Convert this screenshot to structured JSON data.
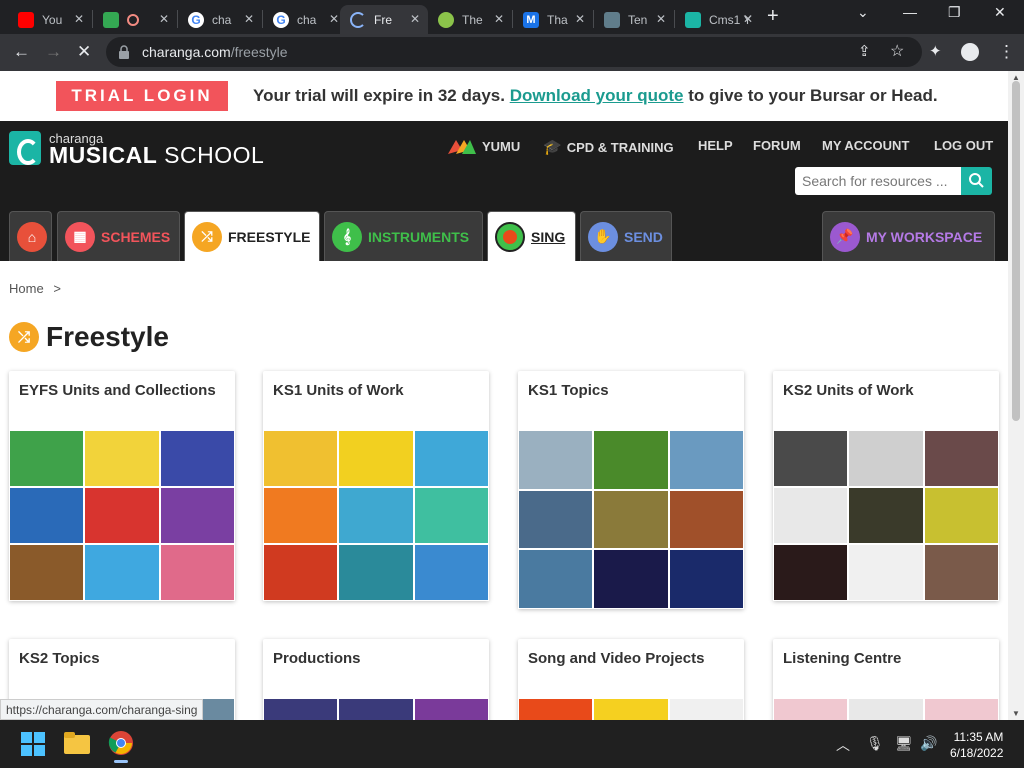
{
  "browser": {
    "tabs": [
      {
        "label": "You",
        "fav": "#ff0000",
        "icon": "youtube-icon"
      },
      {
        "label": "",
        "fav": "#34a853",
        "icon": "meet-icon"
      },
      {
        "label": "cha",
        "fav": "#ffffff",
        "icon": "google-icon"
      },
      {
        "label": "cha",
        "fav": "#ffffff",
        "icon": "google-icon"
      },
      {
        "label": "Fre",
        "fav": "#35363a",
        "icon": "loading-icon",
        "active": true
      },
      {
        "label": "The",
        "fav": "#8bc34a",
        "icon": "wrench-icon"
      },
      {
        "label": "Tha",
        "fav": "#1a73e8",
        "icon": "m-icon"
      },
      {
        "label": "Ten",
        "fav": "#607d8b",
        "icon": "mail-icon"
      },
      {
        "label": "Cms1 Y",
        "fav": "#1bb5a5",
        "icon": "charanga-icon"
      }
    ],
    "url_host": "charanga.com",
    "url_path": "/freestyle",
    "status_url": "https://charanga.com/charanga-sing"
  },
  "trial": {
    "login_label": "TRIAL LOGIN",
    "msg_before": "Your trial will expire in 32 days.",
    "link": "Download your quote",
    "msg_after": "to give to your Bursar or Head."
  },
  "header": {
    "logo_small": "charanga",
    "logo_bold": "MUSICAL",
    "logo_rest": "SCHOOL",
    "nav": [
      "YUMU",
      "CPD & TRAINING",
      "HELP",
      "FORUM",
      "MY ACCOUNT",
      "LOG OUT"
    ],
    "search_placeholder": "Search for resources ..."
  },
  "page_tabs": [
    {
      "label": "",
      "color": "#e8503a",
      "icon": "home-icon"
    },
    {
      "label": "SCHEMES",
      "color": "#f2545b",
      "icon": "grid-icon"
    },
    {
      "label": "FREESTYLE",
      "color": "#f5a623",
      "icon": "shuffle-icon",
      "selected": true
    },
    {
      "label": "INSTRUMENTS",
      "color": "#3fbf4a",
      "icon": "treble-clef-icon"
    },
    {
      "label": "SING",
      "color": "#222222",
      "icon": "singer-icon",
      "selected": true
    },
    {
      "label": "SEND",
      "color": "#6c8fe0",
      "icon": "hand-icon"
    },
    {
      "label": "MY WORKSPACE",
      "color": "#9b59d0",
      "icon": "pin-icon"
    }
  ],
  "breadcrumb": {
    "home": "Home",
    "sep": ">"
  },
  "page_title": "Freestyle",
  "cards": [
    {
      "title": "EYFS Units and Collections",
      "colors": [
        "#3fa24a",
        "#f2d33a",
        "#3a4aa8",
        "#2a6ab8",
        "#d8342f",
        "#7a3fa2",
        "#8a5a2a",
        "#3fa8e0",
        "#e06a8a"
      ]
    },
    {
      "title": "KS1 Units of Work",
      "colors": [
        "#f0c030",
        "#f2d020",
        "#3fa8d8",
        "#f07a20",
        "#3fa8d0",
        "#3fbfa0",
        "#d03a20",
        "#2a8a9a",
        "#3a8ad0"
      ]
    },
    {
      "title": "KS1 Topics",
      "colors": [
        "#9ab0c0",
        "#4a8a2a",
        "#6a9ac0",
        "#4a6a8a",
        "#8a7a3a",
        "#a0502a",
        "#4a7aa0",
        "#1a1a4a",
        "#1a2a6a"
      ]
    },
    {
      "title": "KS2 Units of Work",
      "colors": [
        "#4a4a4a",
        "#cfcfcf",
        "#6a4a4a",
        "#e8e8e8",
        "#3a3a2a",
        "#c8c030",
        "#2a1a1a",
        "#f0f0f0",
        "#7a5a4a"
      ]
    },
    {
      "title": "KS2 Topics",
      "colors": [
        "#6a8aa0",
        "#6a8aa0",
        "#6a8aa0"
      ]
    },
    {
      "title": "Productions",
      "colors": [
        "#3a3a7a",
        "#3a3a7a",
        "#7a3a9a"
      ]
    },
    {
      "title": "Song and Video Projects",
      "colors": [
        "#e84a1a",
        "#f5d020",
        "#f0f0f0"
      ]
    },
    {
      "title": "Listening Centre",
      "colors": [
        "#f0c8d0",
        "#e8e8e8",
        "#f0c8d0"
      ]
    }
  ],
  "taskbar": {
    "time": "11:35 AM",
    "date": "6/18/2022"
  }
}
